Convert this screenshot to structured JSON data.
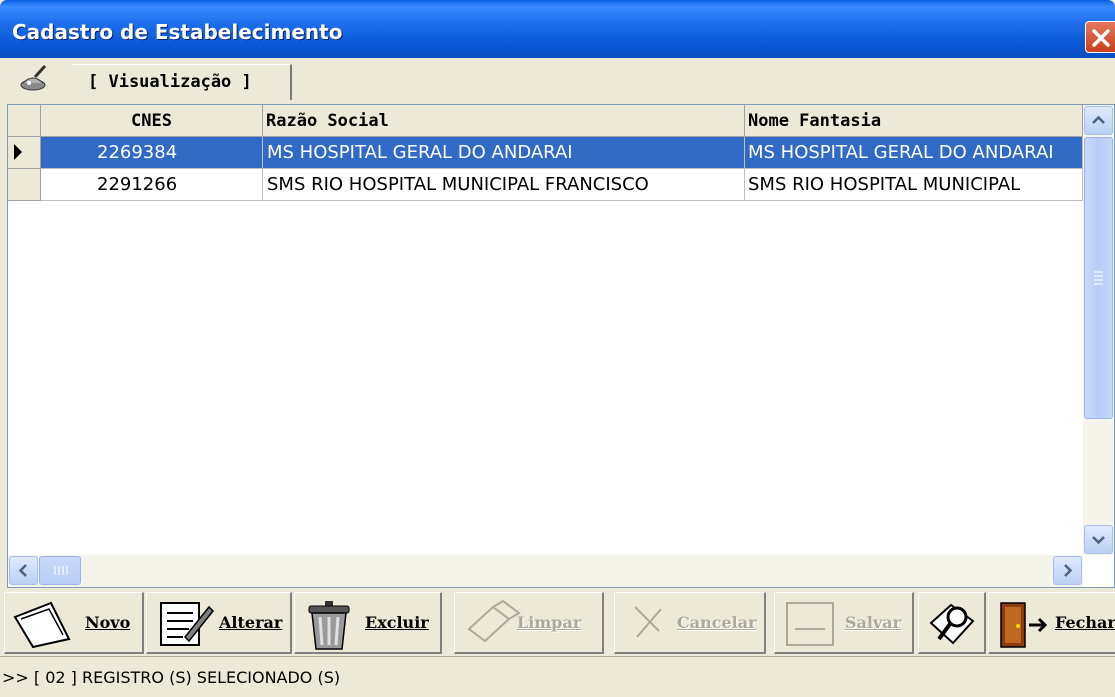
{
  "window": {
    "title": "Cadastro de Estabelecimento"
  },
  "tab": {
    "label": "[ Visualização ]"
  },
  "grid": {
    "columns": [
      "CNES",
      "Razão Social",
      "Nome Fantasia"
    ],
    "rows": [
      {
        "cnes": "2269384",
        "razao_social": "MS HOSPITAL GERAL DO ANDARAI",
        "nome_fantasia": "MS HOSPITAL GERAL DO ANDARAI",
        "selected": true
      },
      {
        "cnes": "2291266",
        "razao_social": "SMS RIO HOSPITAL MUNICIPAL FRANCISCO",
        "nome_fantasia": "SMS RIO HOSPITAL MUNICIPAL",
        "selected": false
      }
    ]
  },
  "toolbar": {
    "novo": "Novo",
    "alterar": "Alterar",
    "excluir": "Excluir",
    "limpar": "Limpar",
    "cancelar": "Cancelar",
    "salvar": "Salvar",
    "fechar": "Fechar"
  },
  "status": {
    "text": ">> [ 02 ] REGISTRO (S) SELECIONADO (S)"
  },
  "colors": {
    "title_bar": "#0A58D6",
    "selection": "#316AC5",
    "face": "#ECE9D8"
  }
}
